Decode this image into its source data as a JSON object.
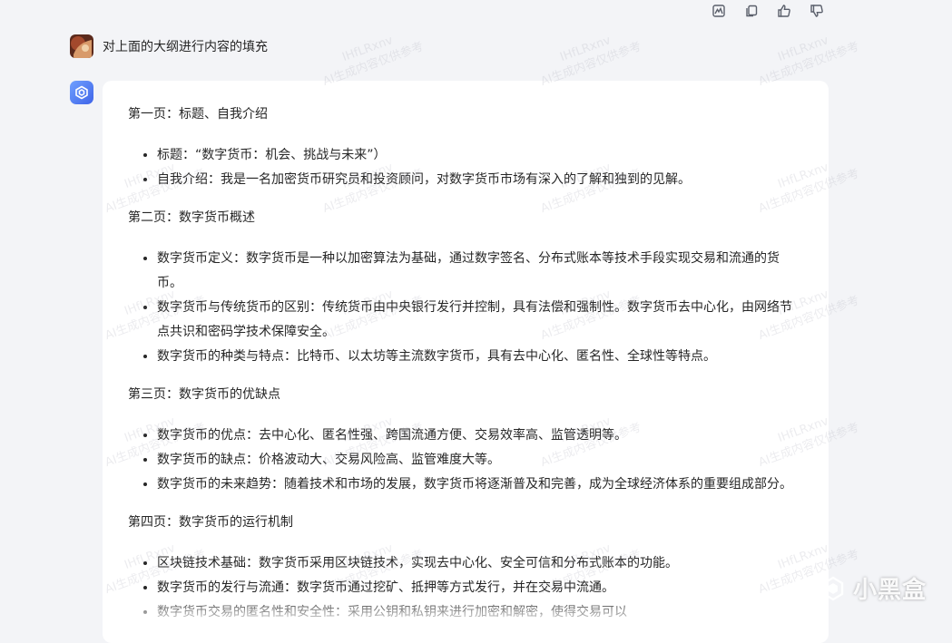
{
  "toolbar": {
    "icons": [
      "image-icon",
      "copy-icon",
      "thumbs-up-icon",
      "thumbs-down-icon"
    ]
  },
  "user_message": "对上面的大纲进行内容的填充",
  "response": {
    "sections": [
      {
        "heading": "第一页：标题、自我介绍",
        "items": [
          "标题：“数字货币：机会、挑战与未来”）",
          "自我介绍：我是一名加密货币研究员和投资顾问，对数字货币市场有深入的了解和独到的见解。"
        ]
      },
      {
        "heading": "第二页：数字货币概述",
        "items": [
          "数字货币定义：数字货币是一种以加密算法为基础，通过数字签名、分布式账本等技术手段实现交易和流通的货币。",
          "数字货币与传统货币的区别：传统货币由中央银行发行并控制，具有法偿和强制性。数字货币去中心化，由网络节点共识和密码学技术保障安全。",
          "数字货币的种类与特点：比特币、以太坊等主流数字货币，具有去中心化、匿名性、全球性等特点。"
        ]
      },
      {
        "heading": "第三页：数字货币的优缺点",
        "items": [
          "数字货币的优点：去中心化、匿名性强、跨国流通方便、交易效率高、监管透明等。",
          "数字货币的缺点：价格波动大、交易风险高、监管难度大等。",
          "数字货币的未来趋势：随着技术和市场的发展，数字货币将逐渐普及和完善，成为全球经济体系的重要组成部分。"
        ]
      },
      {
        "heading": "第四页：数字货币的运行机制",
        "items": [
          "区块链技术基础：数字货币采用区块链技术，实现去中心化、安全可信和分布式账本的功能。",
          "数字货币的发行与流通：数字货币通过挖矿、抵押等方式发行，并在交易中流通。",
          "数字货币交易的匿名性和安全性：采用公钥和私钥来进行加密和解密，使得交易可以"
        ]
      }
    ]
  },
  "watermark": {
    "line1": "IHfLRxnv",
    "line2": "AI生成内容仅供参考"
  },
  "logo": {
    "text": "小黑盒"
  }
}
